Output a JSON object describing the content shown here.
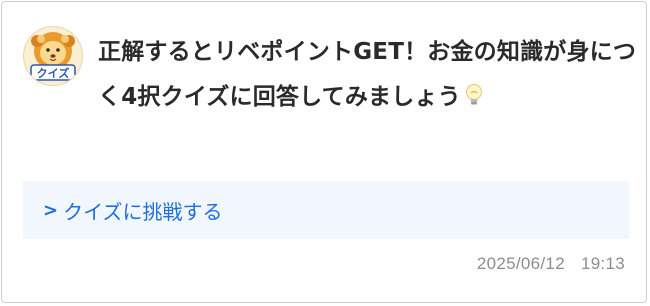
{
  "post": {
    "avatar_label": "クイズ",
    "message": "正解するとリベポイントGET！お金の知識が身につく4択クイズに回答してみましょう",
    "message_icon": "lightbulb-icon",
    "link": {
      "chevron": ">",
      "label": "クイズに挑戦する"
    },
    "date": "2025/06/12",
    "time": "19:13"
  },
  "colors": {
    "link": "#1d6fe0",
    "link_background": "#f2f7fd",
    "text": "#2a2a2a",
    "timestamp": "#8d8d8d",
    "border": "#cfcfcf"
  }
}
